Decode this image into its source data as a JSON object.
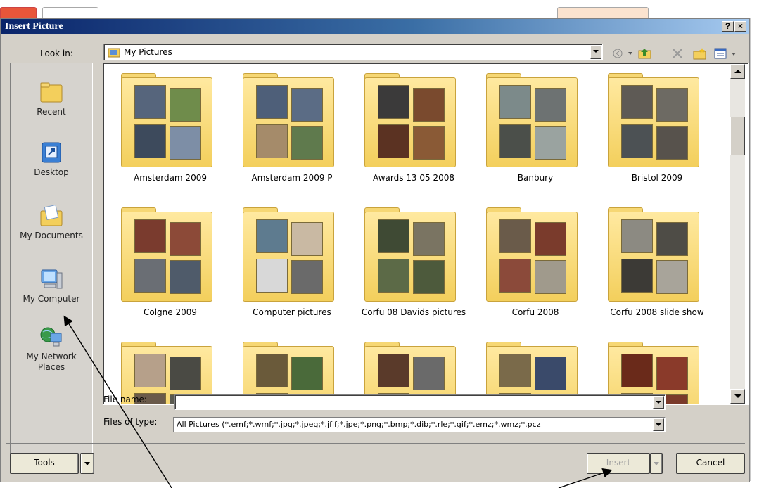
{
  "dialog": {
    "title": "Insert Picture",
    "help_glyph": "?",
    "close_glyph": "×"
  },
  "look_in": {
    "label": "Look in:",
    "value": "My Pictures"
  },
  "places": [
    {
      "label": "Recent",
      "icon": "recent-folder-icon"
    },
    {
      "label": "Desktop",
      "icon": "desktop-icon"
    },
    {
      "label": "My Documents",
      "icon": "my-documents-icon"
    },
    {
      "label": "My Computer",
      "icon": "my-computer-icon"
    },
    {
      "label": "My Network",
      "label2": "Places",
      "icon": "network-places-icon"
    }
  ],
  "folders": [
    {
      "name": "Amsterdam 2009",
      "colors": [
        "#56657c",
        "#6f8c4b",
        "#3d4a5c",
        "#7d8ea6"
      ]
    },
    {
      "name": "Amsterdam 2009 P",
      "colors": [
        "#4e5f79",
        "#5b6c85",
        "#a58b6a",
        "#5f7a4d"
      ]
    },
    {
      "name": "Awards 13 05 2008",
      "colors": [
        "#3b3a3a",
        "#7a4a2e",
        "#5b3222",
        "#8a5a36"
      ]
    },
    {
      "name": "Banbury",
      "colors": [
        "#7c8a8a",
        "#6d7272",
        "#4b4f4a",
        "#9aa3a0"
      ]
    },
    {
      "name": "Bristol 2009",
      "colors": [
        "#5e5a55",
        "#6d6a63",
        "#4c5154",
        "#57524c"
      ]
    },
    {
      "name": "Colgne 2009",
      "colors": [
        "#7a3b2e",
        "#8c4a38",
        "#6a6e74",
        "#4f5b6a"
      ]
    },
    {
      "name": "Computer pictures",
      "colors": [
        "#5e7b8f",
        "#c9b9a3",
        "#d8d8d8",
        "#6a6a6a"
      ]
    },
    {
      "name": "Corfu 08 Davids pictures",
      "colors": [
        "#3f4a34",
        "#7a7462",
        "#5c6a47",
        "#4d5a3c"
      ]
    },
    {
      "name": "Corfu 2008",
      "colors": [
        "#6a5b4a",
        "#7a3b2c",
        "#8b4a3a",
        "#a09a8c"
      ]
    },
    {
      "name": "Corfu 2008 slide show",
      "colors": [
        "#8c8a82",
        "#4e4c46",
        "#3c3a36",
        "#a8a49a"
      ]
    },
    {
      "name": "",
      "colors": [
        "#b6a08a",
        "#4a4a44",
        "#6a5a4a",
        "#5a5a50"
      ]
    },
    {
      "name": "",
      "colors": [
        "#6a5a3a",
        "#4a6a3a",
        "#5a4a3a",
        "#3a4a2a"
      ]
    },
    {
      "name": "",
      "colors": [
        "#5a3a2a",
        "#6a6a6a",
        "#4a3a2a",
        "#7a6a5a"
      ]
    },
    {
      "name": "",
      "colors": [
        "#7a6a4a",
        "#3a4a6a",
        "#5a4a3a",
        "#6a5a4a"
      ]
    },
    {
      "name": "",
      "colors": [
        "#6a2a1a",
        "#8a3a2a",
        "#5a2a1a",
        "#7a3a2a"
      ]
    }
  ],
  "file_name": {
    "label": "File name:",
    "value": ""
  },
  "files_of_type": {
    "label": "Files of type:",
    "value": "All Pictures (*.emf;*.wmf;*.jpg;*.jpeg;*.jfif;*.jpe;*.png;*.bmp;*.dib;*.rle;*.gif;*.emz;*.wmz;*.pcz"
  },
  "buttons": {
    "tools": "Tools",
    "insert": "Insert",
    "cancel": "Cancel"
  },
  "colors": {
    "titlebar_start": "#0a246a",
    "titlebar_end": "#a6caf0",
    "dialog_face": "#d4d0c8",
    "folder_fill": "#f3cf5c"
  }
}
